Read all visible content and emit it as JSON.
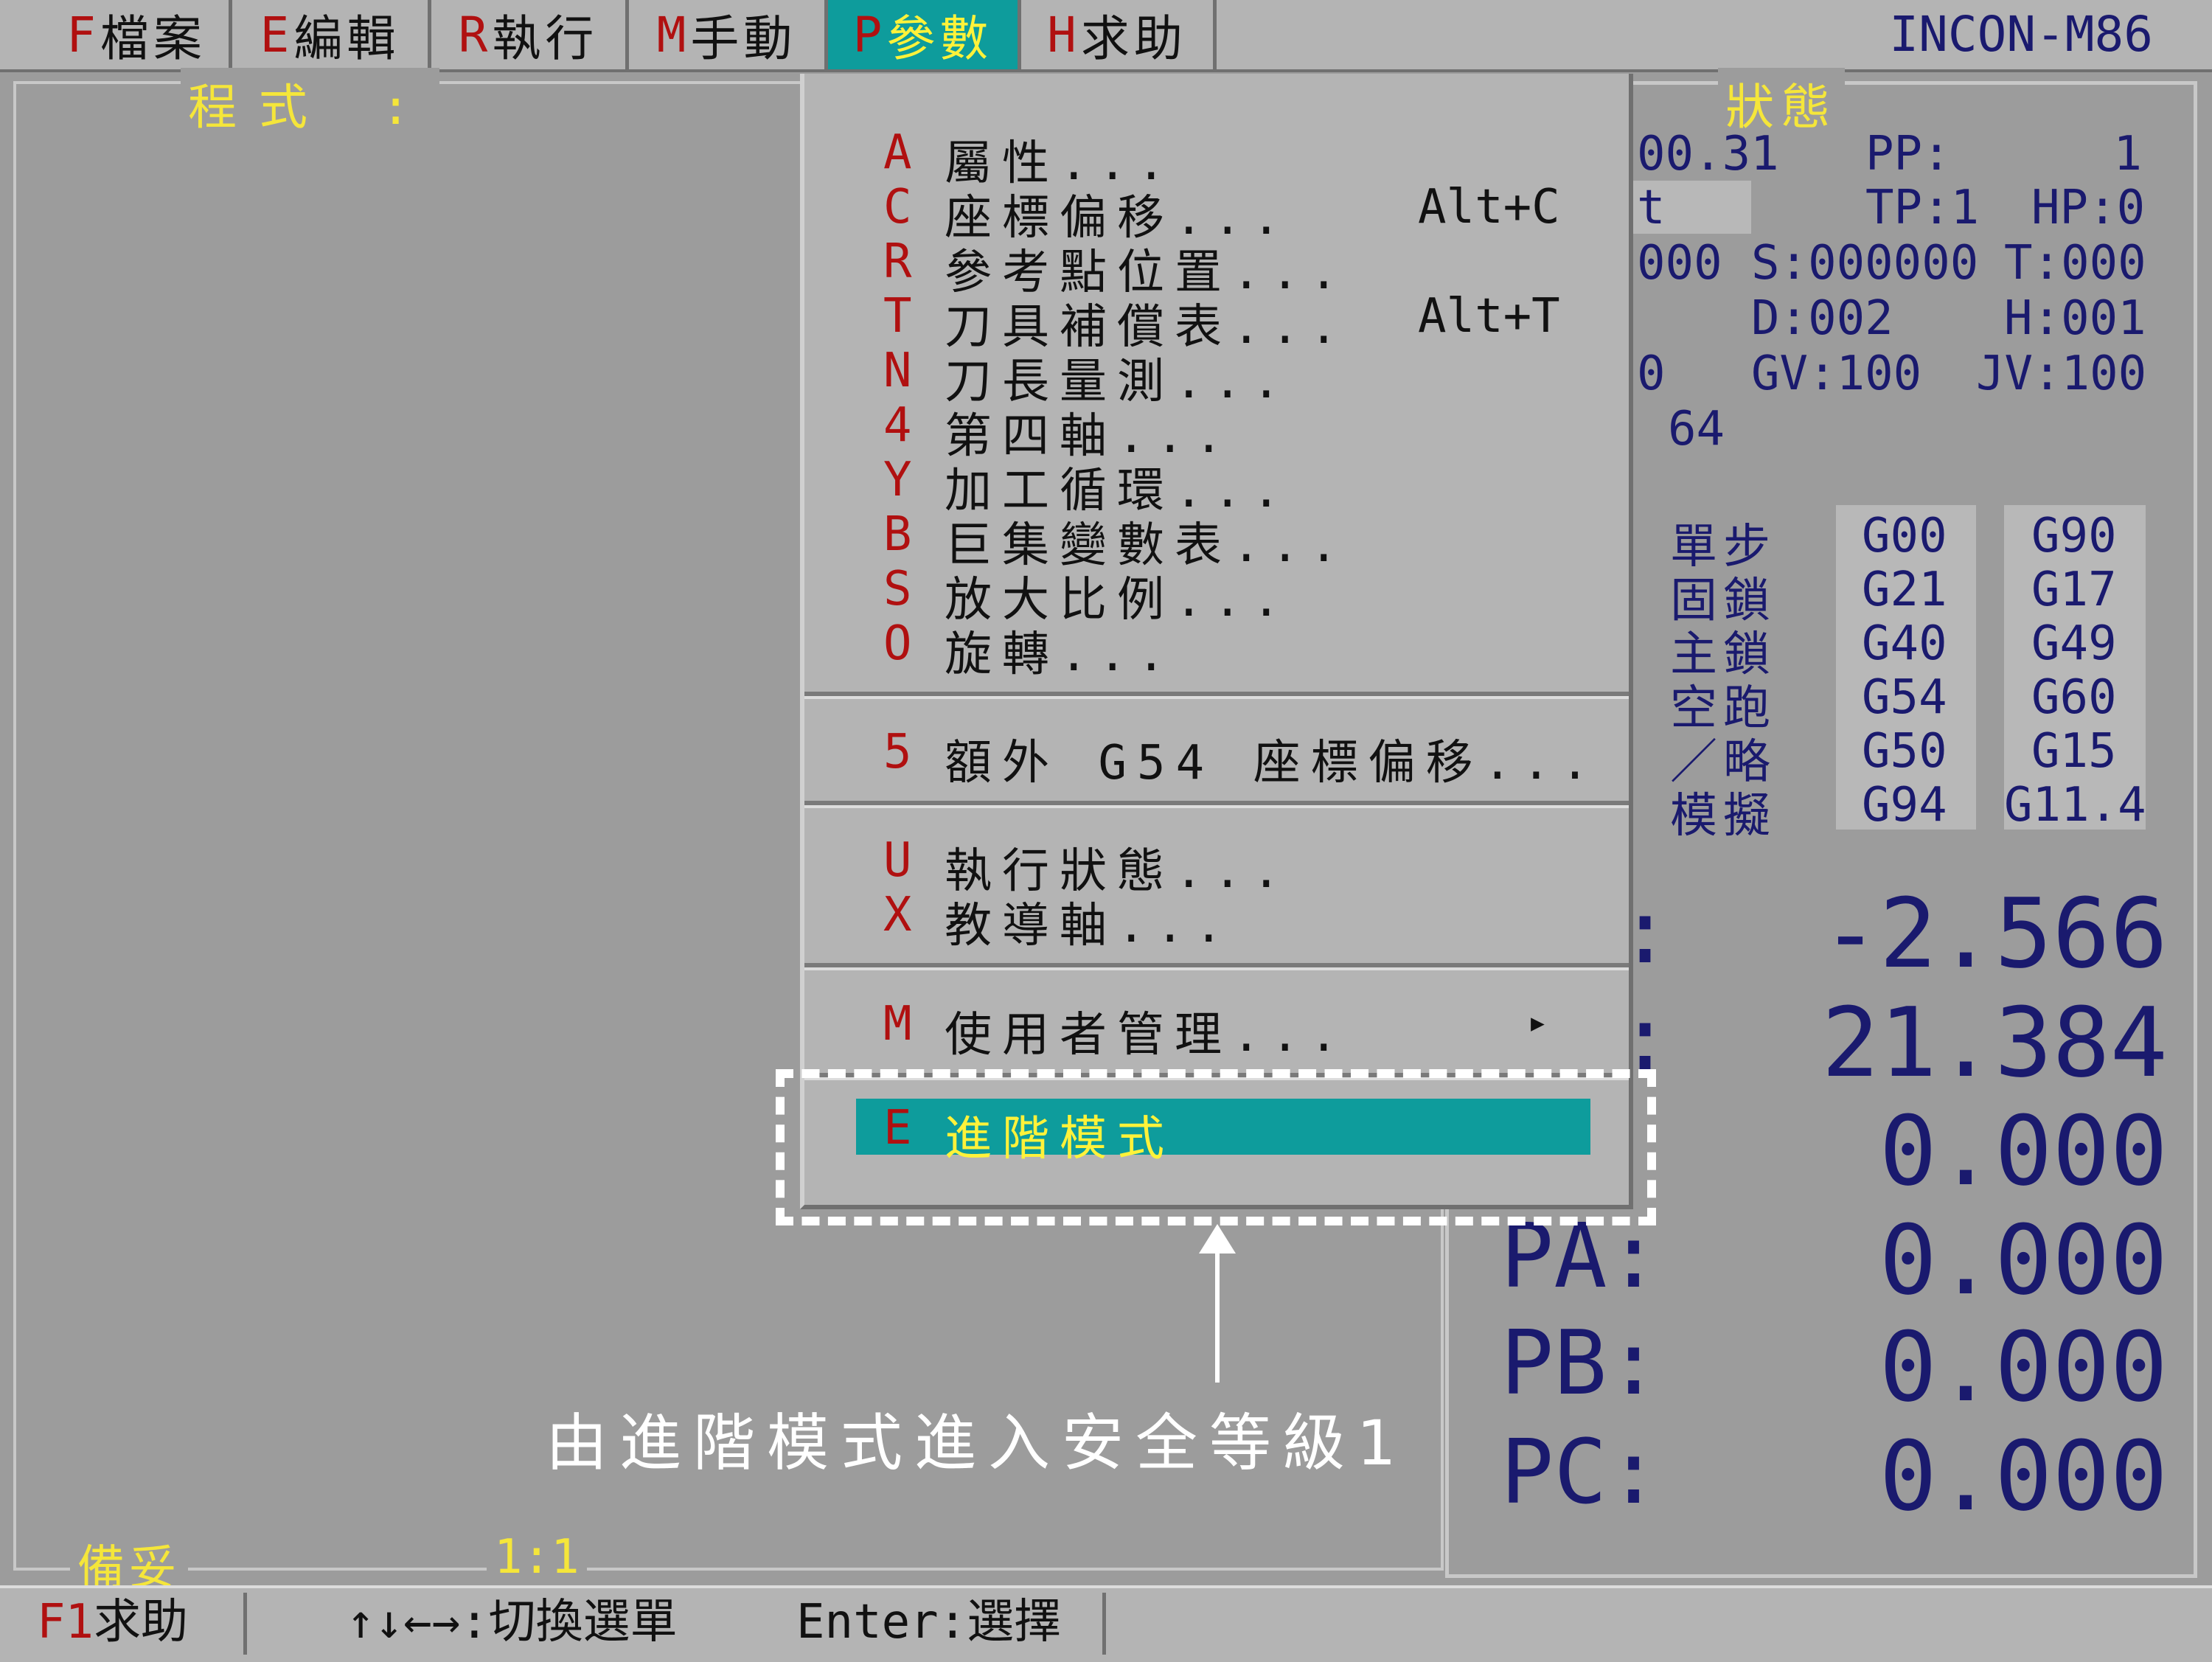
{
  "menubar": {
    "items": [
      {
        "key": "F",
        "label": "檔案"
      },
      {
        "key": "E",
        "label": "編輯"
      },
      {
        "key": "R",
        "label": "執行"
      },
      {
        "key": "M",
        "label": "手動"
      },
      {
        "key": "P",
        "label": "參數"
      },
      {
        "key": "H",
        "label": "求助"
      }
    ],
    "app_title": "INCON-M86"
  },
  "program_panel": {
    "label": "程式 :",
    "status": "備妥",
    "position": "1:1"
  },
  "status_panel": {
    "title": "狀態",
    "lines": [
      {
        "a": "00.31",
        "b": "PP:",
        "c": "1"
      },
      {
        "a": "t",
        "b": "TP:1",
        "c": "HP:0"
      },
      {
        "a": "000",
        "b": "S:000000",
        "c": "T:000"
      },
      {
        "a": "",
        "b": "D:002",
        "c": "H:001"
      },
      {
        "a": "0",
        "b": "GV:100",
        "c": "JV:100"
      },
      {
        "a": "64",
        "b": "",
        "c": ""
      }
    ],
    "modes": [
      "單步",
      "固鎖",
      "主鎖",
      "空跑",
      "／略",
      "模擬"
    ],
    "gcodes_col1": [
      "G00",
      "G21",
      "G40",
      "G54",
      "G50",
      "G94"
    ],
    "gcodes_col2": [
      "G90",
      "G17",
      "G49",
      "G60",
      "G15",
      "G11.4"
    ],
    "axes": [
      {
        "label": ":",
        "value": "-2.566"
      },
      {
        "label": ":",
        "value": "21.384"
      },
      {
        "label": ":",
        "value": "0.000"
      },
      {
        "label": "PA:",
        "value": "0.000"
      },
      {
        "label": "PB:",
        "value": "0.000"
      },
      {
        "label": "PC:",
        "value": "0.000"
      }
    ]
  },
  "dropdown": {
    "items": [
      {
        "key": "A",
        "label": "屬性...",
        "shortcut": ""
      },
      {
        "key": "C",
        "label": "座標偏移...",
        "shortcut": "Alt+C"
      },
      {
        "key": "R",
        "label": "參考點位置...",
        "shortcut": ""
      },
      {
        "key": "T",
        "label": "刀具補償表...",
        "shortcut": "Alt+T"
      },
      {
        "key": "N",
        "label": "刀長量測...",
        "shortcut": ""
      },
      {
        "key": "4",
        "label": "第四軸...",
        "shortcut": ""
      },
      {
        "key": "Y",
        "label": "加工循環...",
        "shortcut": ""
      },
      {
        "key": "B",
        "label": "巨集變數表...",
        "shortcut": ""
      },
      {
        "key": "S",
        "label": "放大比例...",
        "shortcut": ""
      },
      {
        "key": "O",
        "label": "旋轉...",
        "shortcut": ""
      }
    ],
    "extra": {
      "key": "5",
      "label": "額外 G54 座標偏移..."
    },
    "group3": [
      {
        "key": "U",
        "label": "執行狀態..."
      },
      {
        "key": "X",
        "label": "教導軸..."
      }
    ],
    "user_mgmt": {
      "key": "M",
      "label": "使用者管理...",
      "submenu_glyph": "▸"
    },
    "advanced": {
      "key": "E",
      "label": "進階模式"
    }
  },
  "annotation": "由進階模式進入安全等級1",
  "statusbar": {
    "help_key": "F1",
    "help_label": "求助",
    "nav_text": "↑↓←→:切換選單",
    "enter_text": "Enter:選擇"
  },
  "colors": {
    "highlight": "#0e9c9c",
    "accent_key": "#b01010",
    "yellow": "#f5e63a",
    "navy": "#1a1a6e"
  }
}
